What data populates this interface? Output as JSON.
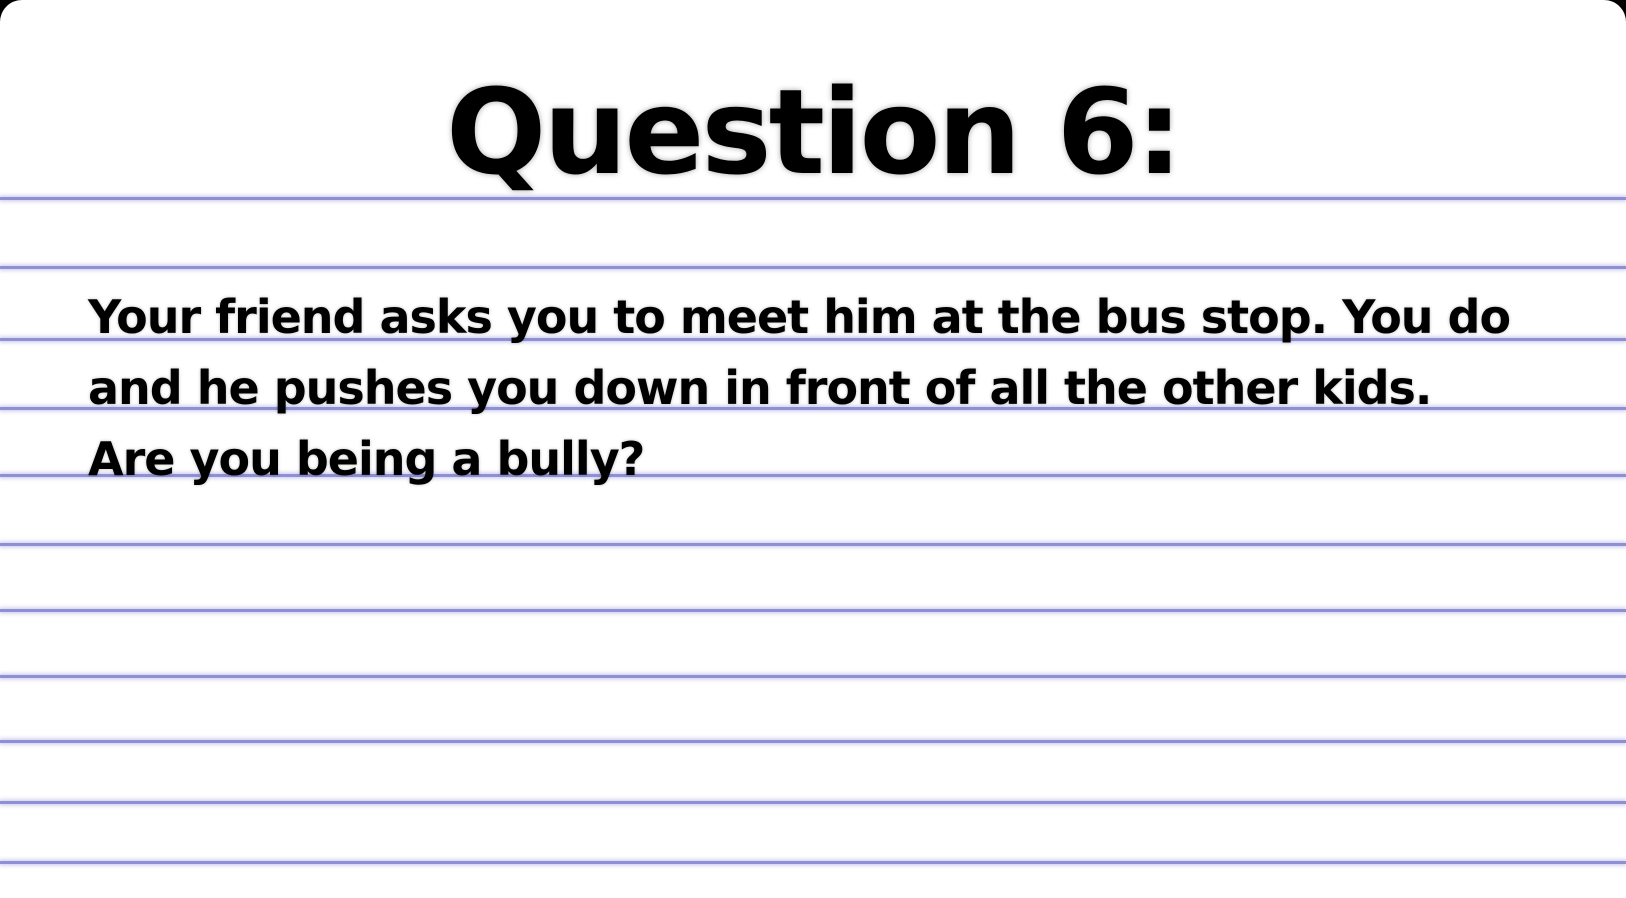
{
  "slide": {
    "title": "Question 6:",
    "question_lines": [
      "Your friend asks you to meet him at the bus stop. You do",
      "and he pushes you down in front of all the other kids.",
      "Are you being a bully?"
    ]
  },
  "colors": {
    "paper": "#ffffff",
    "rule_lines": "#8f8fd6",
    "text": "#000000",
    "background": "#000000"
  }
}
